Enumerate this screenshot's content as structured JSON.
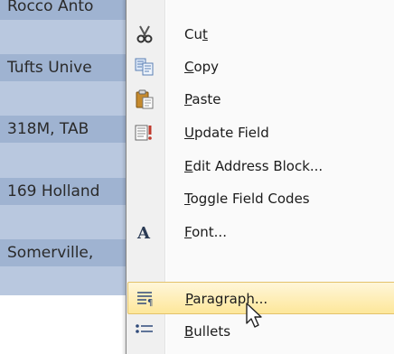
{
  "document": {
    "lines": [
      "Rocco Anto",
      "Tufts Unive",
      "318M, TAB",
      "169 Holland",
      "Somerville,"
    ]
  },
  "menu": {
    "items": [
      {
        "label": "Cut",
        "accel_index": 2,
        "icon": "scissors-icon"
      },
      {
        "label": "Copy",
        "accel_index": 0,
        "icon": "copy-icon"
      },
      {
        "label": "Paste",
        "accel_index": 0,
        "icon": "paste-icon"
      },
      {
        "label": "Update Field",
        "accel_index": 0,
        "icon": "update-field-icon"
      },
      {
        "label": "Edit Address Block...",
        "accel_index": 0,
        "icon": ""
      },
      {
        "label": "Toggle Field Codes",
        "accel_index": 0,
        "icon": ""
      },
      {
        "label": "Font...",
        "accel_index": 0,
        "icon": "font-icon"
      },
      {
        "label": "Paragraph...",
        "accel_index": 0,
        "icon": "paragraph-icon",
        "highlighted": true
      },
      {
        "label": "Bullets",
        "accel_index": 0,
        "icon": "bullets-icon"
      }
    ]
  },
  "colors": {
    "selection": "#9fb3d1",
    "highlight_border": "#e3c26b",
    "highlight_fill": "#fde79a"
  }
}
